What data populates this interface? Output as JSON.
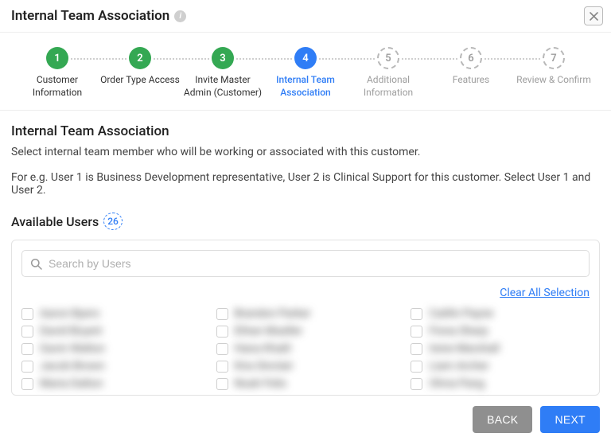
{
  "header": {
    "title": "Internal Team Association"
  },
  "steps": [
    {
      "num": "1",
      "label": "Customer Information",
      "state": "done"
    },
    {
      "num": "2",
      "label": "Order Type Access",
      "state": "done"
    },
    {
      "num": "3",
      "label": "Invite Master Admin (Customer)",
      "state": "done"
    },
    {
      "num": "4",
      "label": "Internal Team Association",
      "state": "current"
    },
    {
      "num": "5",
      "label": "Additional Information",
      "state": "pending"
    },
    {
      "num": "6",
      "label": "Features",
      "state": "pending"
    },
    {
      "num": "7",
      "label": "Review & Confirm",
      "state": "pending"
    }
  ],
  "section": {
    "title": "Internal Team Association",
    "description": "Select internal team member who will be working or associated with this customer.",
    "example": "For e.g. User 1 is Business Development representative, User 2 is Clinical Support for this customer. Select User 1 and User 2.",
    "available_label": "Available Users",
    "count": "26",
    "search_placeholder": "Search by Users",
    "clear_all": "Clear All Selection"
  },
  "users": [
    "Aaron Byers",
    "Brandon Parker",
    "Caitlin Payne",
    "David Bryant",
    "Ethan Mueller",
    "Fiona Sharp",
    "Gavin Walton",
    "Hana Khalil",
    "Irene Marshall",
    "Jacob Brown",
    "Kira Sinclair",
    "Liam Archer",
    "Maria Dalton",
    "Noah Felix",
    "Olivia Pang"
  ],
  "footer": {
    "back": "BACK",
    "next": "NEXT"
  }
}
